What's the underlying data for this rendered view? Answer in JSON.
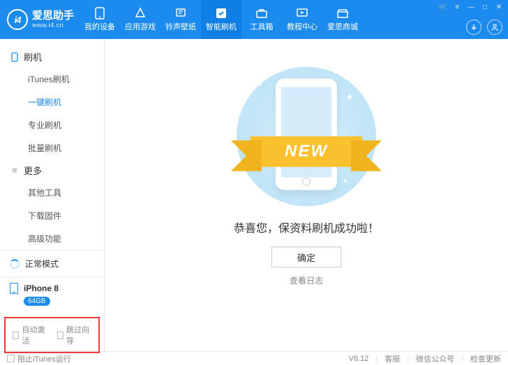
{
  "app": {
    "name": "爱思助手",
    "site": "www.i4.cn",
    "logo_mark": "i4"
  },
  "nav": [
    {
      "icon": "phone",
      "label": "我的设备"
    },
    {
      "icon": "apps",
      "label": "应用游戏"
    },
    {
      "icon": "ringtone",
      "label": "铃声壁纸"
    },
    {
      "icon": "flash",
      "label": "智能刷机",
      "active": true
    },
    {
      "icon": "toolbox",
      "label": "工具箱"
    },
    {
      "icon": "tutorial",
      "label": "教程中心"
    },
    {
      "icon": "store",
      "label": "爱思商城"
    }
  ],
  "sidebar": {
    "section1": {
      "title": "刷机",
      "items": [
        "iTunes刷机",
        "一键刷机",
        "专业刷机",
        "批量刷机"
      ],
      "activeIndex": 1
    },
    "section2": {
      "title": "更多",
      "items": [
        "其他工具",
        "下载固件",
        "高级功能"
      ]
    },
    "status": "正常模式",
    "device": {
      "name": "iPhone 8",
      "storage": "64GB"
    },
    "bottom_checks": [
      "自动激活",
      "跳过向导"
    ]
  },
  "main": {
    "ribbon": "NEW",
    "message": "恭喜您，保资料刷机成功啦！",
    "ok": "确定",
    "log": "查看日志"
  },
  "footer": {
    "block_itunes": "阻止iTunes运行",
    "version": "V8.12",
    "support": "客服",
    "wechat": "微信公众号",
    "update": "检查更新"
  }
}
